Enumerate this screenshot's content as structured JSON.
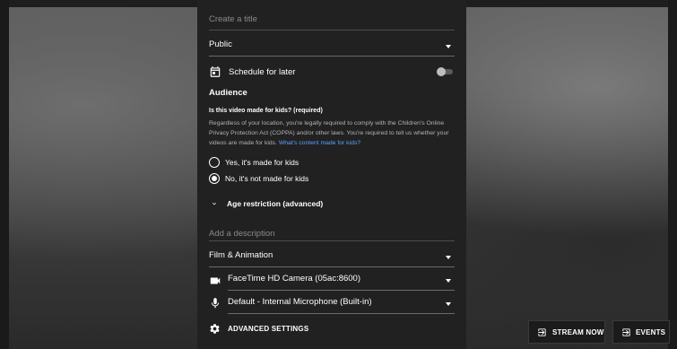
{
  "form": {
    "title_placeholder": "Create a title",
    "visibility": "Public",
    "schedule_label": "Schedule for later",
    "schedule_enabled": false,
    "audience_heading": "Audience",
    "audience_question": "Is this video made for kids? (required)",
    "audience_text": "Regardless of your location, you're legally required to comply with the Children's Online Privacy Protection Act (COPPA) and/or other laws. You're required to tell us whether your videos are made for kids.",
    "audience_link": "What's content made for kids?",
    "option_yes": "Yes, it's made for kids",
    "option_no": "No, it's not made for kids",
    "selected_option": "no",
    "age_restriction_label": "Age restriction (advanced)",
    "description_placeholder": "Add a description",
    "category": "Film & Animation",
    "camera": "FaceTime HD Camera (05ac:8600)",
    "microphone": "Default - Internal Microphone (Built-in)",
    "advanced_settings_label": "ADVANCED SETTINGS"
  },
  "actions": {
    "stream_now": "STREAM NOW",
    "events": "EVENTS"
  },
  "icons": {
    "schedule": "calendar-icon",
    "camera": "videocam-icon",
    "microphone": "mic-icon",
    "advanced": "gear-icon",
    "age": "chevron-down-icon",
    "stream_now": "login-icon",
    "events": "login-icon"
  },
  "colors": {
    "panel": "#212121",
    "link": "#5aa2ff"
  }
}
